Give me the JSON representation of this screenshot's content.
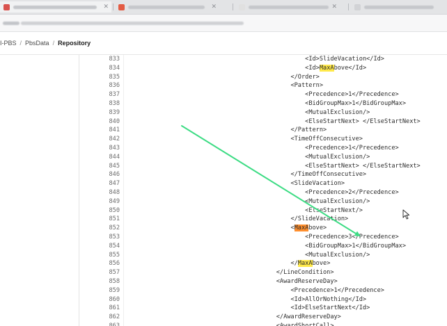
{
  "breadcrumb": {
    "items": [
      "I-PBS",
      "PbsData",
      "Repository"
    ],
    "separator": "/"
  },
  "colors": {
    "highlight_match": "#ffe94a",
    "highlight_current": "#ff8f2e",
    "annotation_arrow": "#3ddc84"
  },
  "editor": {
    "lines": [
      {
        "n": "833",
        "indent": 12,
        "parts": [
          {
            "t": "<Id>SlideVacation</Id>"
          }
        ]
      },
      {
        "n": "834",
        "indent": 12,
        "parts": [
          {
            "t": "<Id>"
          },
          {
            "t": "MaxA",
            "hl": "y"
          },
          {
            "t": "bove</Id>"
          }
        ]
      },
      {
        "n": "835",
        "indent": 8,
        "parts": [
          {
            "t": "</Order>"
          }
        ]
      },
      {
        "n": "836",
        "indent": 8,
        "parts": [
          {
            "t": "<Pattern>"
          }
        ]
      },
      {
        "n": "837",
        "indent": 12,
        "parts": [
          {
            "t": "<Precedence>1</Precedence>"
          }
        ]
      },
      {
        "n": "838",
        "indent": 12,
        "parts": [
          {
            "t": "<BidGroupMax>1</BidGroupMax>"
          }
        ]
      },
      {
        "n": "839",
        "indent": 12,
        "parts": [
          {
            "t": "<MutualExclusion/>"
          }
        ]
      },
      {
        "n": "840",
        "indent": 12,
        "parts": [
          {
            "t": "<ElseStartNext> </ElseStartNext>"
          }
        ]
      },
      {
        "n": "841",
        "indent": 8,
        "parts": [
          {
            "t": "</Pattern>"
          }
        ]
      },
      {
        "n": "842",
        "indent": 8,
        "parts": [
          {
            "t": "<TimeOffConsecutive>"
          }
        ]
      },
      {
        "n": "843",
        "indent": 12,
        "parts": [
          {
            "t": "<Precedence>1</Precedence>"
          }
        ]
      },
      {
        "n": "844",
        "indent": 12,
        "parts": [
          {
            "t": "<MutualExclusion/>"
          }
        ]
      },
      {
        "n": "845",
        "indent": 12,
        "parts": [
          {
            "t": "<ElseStartNext> </ElseStartNext>"
          }
        ]
      },
      {
        "n": "846",
        "indent": 8,
        "parts": [
          {
            "t": "</TimeOffConsecutive>"
          }
        ]
      },
      {
        "n": "847",
        "indent": 8,
        "parts": [
          {
            "t": "<SlideVacation>"
          }
        ]
      },
      {
        "n": "848",
        "indent": 12,
        "parts": [
          {
            "t": "<Precedence>2</Precedence>"
          }
        ]
      },
      {
        "n": "849",
        "indent": 12,
        "parts": [
          {
            "t": "<MutualExclusion/>"
          }
        ]
      },
      {
        "n": "850",
        "indent": 12,
        "parts": [
          {
            "t": "<ElseStartNext/>"
          }
        ]
      },
      {
        "n": "851",
        "indent": 8,
        "parts": [
          {
            "t": "</SlideVacation>"
          }
        ]
      },
      {
        "n": "852",
        "indent": 8,
        "parts": [
          {
            "t": "<"
          },
          {
            "t": "MaxA",
            "hl": "o"
          },
          {
            "t": "bove>"
          }
        ]
      },
      {
        "n": "853",
        "indent": 12,
        "parts": [
          {
            "t": "<Precedence>3</Precedence>"
          }
        ]
      },
      {
        "n": "854",
        "indent": 12,
        "parts": [
          {
            "t": "<BidGroupMax>1</BidGroupMax>"
          }
        ]
      },
      {
        "n": "855",
        "indent": 12,
        "parts": [
          {
            "t": "<MutualExclusion/>"
          }
        ]
      },
      {
        "n": "856",
        "indent": 8,
        "parts": [
          {
            "t": "</"
          },
          {
            "t": "MaxA",
            "hl": "y"
          },
          {
            "t": "bove>"
          }
        ]
      },
      {
        "n": "857",
        "indent": 4,
        "parts": [
          {
            "t": "</LineCondition>"
          }
        ]
      },
      {
        "n": "858",
        "indent": 4,
        "parts": [
          {
            "t": "<AwardReserveDay>"
          }
        ]
      },
      {
        "n": "859",
        "indent": 8,
        "parts": [
          {
            "t": "<Precedence>1</Precedence>"
          }
        ]
      },
      {
        "n": "860",
        "indent": 8,
        "parts": [
          {
            "t": "<Id>AllOrNothing</Id>"
          }
        ]
      },
      {
        "n": "861",
        "indent": 8,
        "parts": [
          {
            "t": "<Id>ElseStartNext</Id>"
          }
        ]
      },
      {
        "n": "862",
        "indent": 4,
        "parts": [
          {
            "t": "</AwardReserveDay>"
          }
        ]
      },
      {
        "n": "863",
        "indent": 4,
        "parts": [
          {
            "t": "<AwardShortCall>"
          }
        ]
      }
    ]
  }
}
